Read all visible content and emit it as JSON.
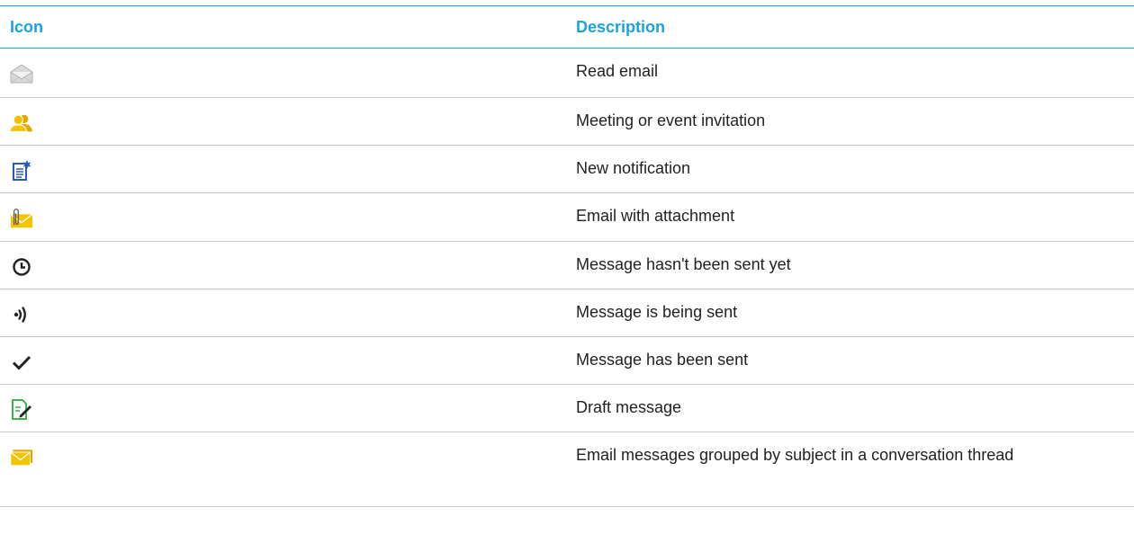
{
  "table": {
    "headers": {
      "icon": "Icon",
      "description": "Description"
    },
    "rows": [
      {
        "icon": "read-email-icon",
        "description": "Read email"
      },
      {
        "icon": "meeting-invitation-icon",
        "description": "Meeting or event invitation"
      },
      {
        "icon": "new-notification-icon",
        "description": "New notification"
      },
      {
        "icon": "email-attachment-icon",
        "description": "Email with attachment"
      },
      {
        "icon": "clock-icon",
        "description": "Message hasn't been sent yet"
      },
      {
        "icon": "sending-icon",
        "description": "Message is being sent"
      },
      {
        "icon": "checkmark-icon",
        "description": "Message has been sent"
      },
      {
        "icon": "draft-icon",
        "description": "Draft message"
      },
      {
        "icon": "conversation-thread-icon",
        "description": "Email messages grouped by subject in a conversation thread"
      }
    ]
  },
  "colors": {
    "accent": "#1aa3d9",
    "divider": "#c9c9c9",
    "text": "#231f20",
    "email_yellow": "#f5c400",
    "draft_green": "#3cb44a",
    "notification_blue": "#2a5db0",
    "read_gray": "#b5b5b5",
    "dark_glyph": "#222222"
  }
}
